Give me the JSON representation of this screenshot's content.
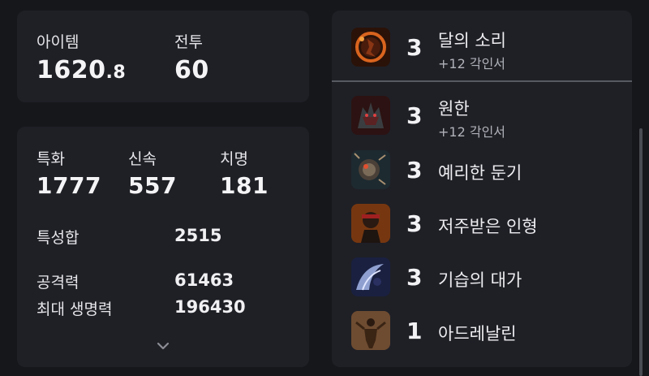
{
  "item_card": {
    "item_label": "아이템",
    "item_value_int": "1620",
    "item_value_frac": ".8",
    "combat_label": "전투",
    "combat_value": "60"
  },
  "stats_card": {
    "crit_spec_label": "특화",
    "crit_spec_value": "1777",
    "swift_label": "신속",
    "swift_value": "557",
    "crit_label": "치명",
    "crit_value": "181",
    "sum_label": "특성합",
    "sum_value": "2515",
    "attack_label": "공격력",
    "attack_value": "61463",
    "hp_label": "최대 생명력",
    "hp_value": "196430"
  },
  "engravings": [
    {
      "level": "3",
      "name": "달의 소리",
      "sub": "+12 각인서",
      "icon": "moon-sound-icon"
    },
    {
      "level": "3",
      "name": "원한",
      "sub": "+12 각인서",
      "icon": "grudge-icon"
    },
    {
      "level": "3",
      "name": "예리한 둔기",
      "sub": "",
      "icon": "keen-blunt-weapon-icon"
    },
    {
      "level": "3",
      "name": "저주받은 인형",
      "sub": "",
      "icon": "cursed-doll-icon"
    },
    {
      "level": "3",
      "name": "기습의 대가",
      "sub": "",
      "icon": "master-of-ambush-icon"
    },
    {
      "level": "1",
      "name": "아드레날린",
      "sub": "",
      "icon": "adrenaline-icon"
    }
  ]
}
